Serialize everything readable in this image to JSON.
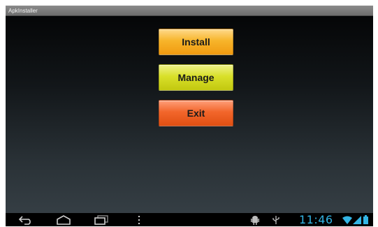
{
  "window": {
    "title": "ApkInstaller"
  },
  "buttons": {
    "install": "Install",
    "manage": "Manage",
    "exit": "Exit"
  },
  "status_bar": {
    "time": "11:46",
    "icons": [
      "android-debug-icon",
      "usb-icon",
      "wifi-icon",
      "signal-icon",
      "battery-icon"
    ]
  },
  "navigation": {
    "icons": [
      "back-icon",
      "home-icon",
      "recent-apps-icon",
      "menu-icon"
    ]
  },
  "colors": {
    "accent": "#33b5e5",
    "install": "#f7b52b",
    "manage": "#d9e02a",
    "exit": "#f2662b"
  }
}
